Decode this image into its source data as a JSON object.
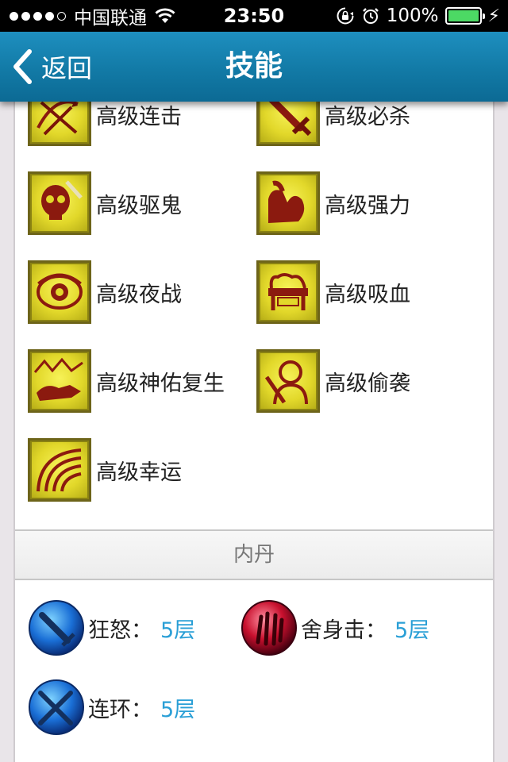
{
  "status_bar": {
    "carrier": "中国联通",
    "time": "23:50",
    "battery_percent": "100%",
    "signal_bars_filled": 4,
    "signal_bars_total": 5,
    "icons": [
      "wifi-icon",
      "rotation-lock-icon",
      "alarm-icon",
      "battery-icon",
      "charging-icon"
    ]
  },
  "nav": {
    "back_label": "返回",
    "title": "技能",
    "color": "#1584b3"
  },
  "skills": [
    {
      "name": "高级连击",
      "icon": "crossed-arrows-icon"
    },
    {
      "name": "高级必杀",
      "icon": "sword-icon"
    },
    {
      "name": "高级驱鬼",
      "icon": "skull-icon"
    },
    {
      "name": "高级强力",
      "icon": "flexed-arm-icon"
    },
    {
      "name": "高级夜战",
      "icon": "eye-icon"
    },
    {
      "name": "高级吸血",
      "icon": "bloody-altar-icon"
    },
    {
      "name": "高级神佑复生",
      "icon": "beast-landscape-icon"
    },
    {
      "name": "高级偷袭",
      "icon": "hooded-figure-icon"
    },
    {
      "name": "高级幸运",
      "icon": "rainbow-icon"
    }
  ],
  "inner_dan": {
    "header": "内丹",
    "items": [
      {
        "name": "狂怒",
        "value": "5层",
        "icon": "blue-sword-orb-icon",
        "color": "#1a6fd6"
      },
      {
        "name": "舍身击",
        "value": "5层",
        "icon": "red-claw-orb-icon",
        "color": "#c8102e"
      },
      {
        "name": "连环",
        "value": "5层",
        "icon": "blue-crossed-swords-orb-icon",
        "color": "#1a6fd6"
      }
    ],
    "value_color": "#2a9fd6"
  }
}
